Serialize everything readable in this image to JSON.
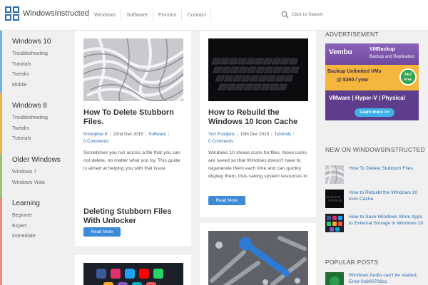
{
  "header": {
    "site_title": "WindowsInstructed",
    "nav": [
      "Windows",
      "Software",
      "Forums",
      "Contact"
    ],
    "search_placeholder": "Click to Search"
  },
  "sidebar": {
    "categories": [
      {
        "title": "Windows 10",
        "color": "#6bb5e3",
        "links": [
          "Troubleshooting",
          "Tutorials",
          "Tweaks",
          "Mobile"
        ]
      },
      {
        "title": "Windows 8",
        "color": "#f0b24d",
        "links": [
          "Troubleshooting",
          "Tweaks",
          "Tutorials"
        ]
      },
      {
        "title": "Older Windows",
        "color": "#96c874",
        "links": [
          "Windows 7",
          "Windows Vista"
        ]
      },
      {
        "title": "Learning",
        "color": "#ee8a7e",
        "links": [
          "Beginner",
          "Expert",
          "Immediate"
        ]
      }
    ]
  },
  "posts": [
    {
      "title": "How To Delete Stubborn Files.",
      "author": "Kristopher K",
      "date": "22nd Dec 2015",
      "category": "Software",
      "comments": "0 Comments",
      "excerpt": "Sometimes you run across a file that you can not delete, no matter what you try. This guide is aimed at helping you with that issue.",
      "subtitle": "Deleting Stubborn Files With Unlocker",
      "button": "Read More"
    },
    {
      "title": "How to Rebuild the Windows 10 Icon Cache",
      "author": "Yuri Poslijens",
      "date": "19th Dec 2015",
      "category": "Tutorials",
      "comments": "0 Comments",
      "excerpt": "Windows 10 shows icons for files, those icons are saved so that Windows doesn't have to regenerate them each time and can quickly display them, thus saving system resources in",
      "button": "Read More"
    }
  ],
  "right": {
    "advertisement_label": "ADVERTISEMENT",
    "ad": {
      "brand": "Vembu",
      "product": "VMBackup",
      "tagline": "Backup and Replication",
      "headline": "Backup Unlimited VMs",
      "price": "@ $360 / year",
      "badge": "24x7 Free",
      "platforms": "VMware | Hyper-V | Physical",
      "cta": "Learn more >>"
    },
    "new_label": "NEW ON WINDOWSINSTRUCTED",
    "new_items": [
      "How To Delete Stubborn Files.",
      "How to Rebuild the Windows 10 Icon Cache",
      "How to Save Windows Store Apps to External Storage in Windows 10"
    ],
    "popular_label": "POPULAR POSTS",
    "popular_items": [
      "Windows Audio can't be started, Error 0x800706cc"
    ]
  }
}
